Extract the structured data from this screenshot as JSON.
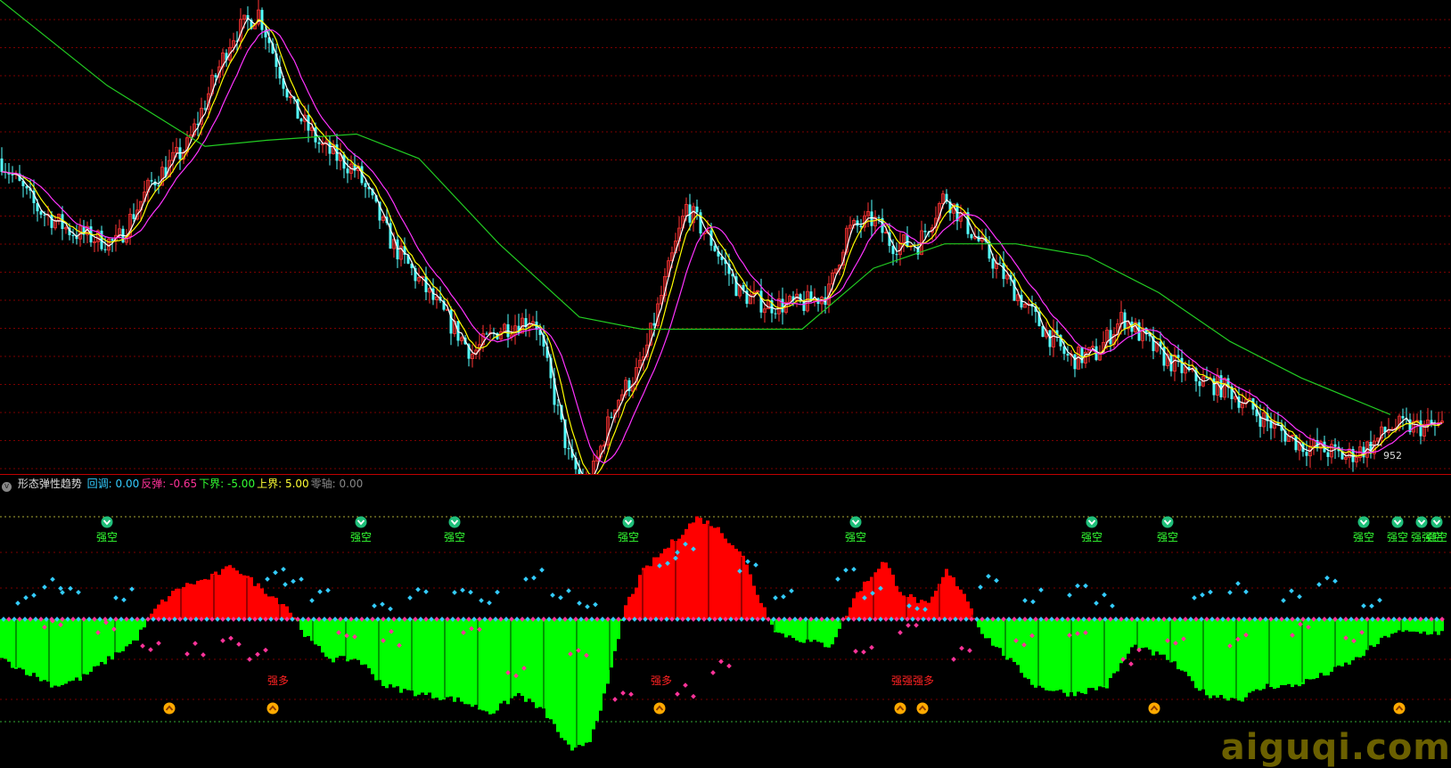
{
  "indicator": {
    "name": "形态弹性趋势",
    "items": [
      {
        "label": "回调",
        "value": "0.00",
        "color": "#33ccff"
      },
      {
        "label": "反弹",
        "value": "-0.65",
        "color": "#ff3399"
      },
      {
        "label": "下界",
        "value": "-5.00",
        "color": "#33ff33"
      },
      {
        "label": "上界",
        "value": "5.00",
        "color": "#ffff33"
      },
      {
        "label": "零轴",
        "value": "0.00",
        "color": "#888888"
      }
    ]
  },
  "price_low_label": "952",
  "watermark": "aiguqi.com",
  "colors": {
    "up": "#ff3333",
    "down": "#54ffff",
    "ma_short": "#ffffff",
    "ma_mid": "#ffff00",
    "ma_long": "#ff33ff",
    "ma_trend": "#22cc22",
    "hist_pos": "#ff0000",
    "hist_neg": "#00ff00",
    "grid": "#7a0000"
  },
  "chart_data": [
    {
      "type": "candlestick",
      "title": "",
      "series": [
        {
          "kind": "close-path",
          "x": [
            0,
            40,
            80,
            130,
            170,
            210,
            260,
            290,
            330,
            360,
            400,
            440,
            490,
            530,
            560,
            600,
            640,
            660,
            690,
            720,
            770,
            800,
            830,
            860,
            900,
            930,
            950,
            980,
            1000,
            1030,
            1060,
            1090,
            1120,
            1160,
            1200,
            1230,
            1260,
            1300,
            1340,
            1380,
            1420,
            1460,
            1490,
            1510,
            1540,
            1560
          ],
          "y": [
            1130,
            1090,
            1070,
            1060,
            1110,
            1140,
            1230,
            1250,
            1170,
            1140,
            1120,
            1060,
            1010,
            970,
            990,
            1000,
            880,
            860,
            930,
            960,
            1090,
            1060,
            1020,
            1010,
            1010,
            1020,
            1070,
            1080,
            1060,
            1060,
            1100,
            1070,
            1040,
            1000,
            965,
            970,
            1000,
            970,
            950,
            940,
            915,
            895,
            890,
            885,
            895,
            910
          ]
        },
        {
          "kind": "ma-trend",
          "x": [
            0,
            120,
            230,
            300,
            400,
            470,
            560,
            650,
            720,
            800,
            900,
            980,
            1060,
            1140,
            1220,
            1300,
            1380,
            1460,
            1560
          ],
          "y": [
            1260,
            1190,
            1140,
            1145,
            1150,
            1130,
            1060,
            1000,
            990,
            990,
            990,
            1040,
            1060,
            1060,
            1050,
            1020,
            980,
            950,
            920
          ]
        }
      ],
      "ylim": [
        880,
        1260
      ],
      "annotations": [
        {
          "text": "952",
          "kind": "low-marker"
        }
      ]
    },
    {
      "type": "bar",
      "title": "形态弹性趋势",
      "series": [
        {
          "name": "histogram",
          "x": [
            0,
            30,
            60,
            90,
            120,
            150,
            175,
            200,
            230,
            260,
            290,
            320,
            345,
            370,
            400,
            430,
            470,
            510,
            550,
            580,
            610,
            640,
            660,
            680,
            700,
            720,
            750,
            780,
            800,
            830,
            850,
            870,
            900,
            930,
            960,
            990,
            1010,
            1040,
            1060,
            1080,
            1100,
            1130,
            1160,
            1200,
            1240,
            1270,
            1310,
            1350,
            1390,
            1420,
            1450,
            1490,
            1520,
            1560
          ],
          "values": [
            -1.5,
            -2.0,
            -2.5,
            -2.2,
            -1.5,
            -0.8,
            0.5,
            1.2,
            1.5,
            2.0,
            1.2,
            0.5,
            -0.8,
            -1.5,
            -1.5,
            -2.5,
            -2.8,
            -3.0,
            -3.5,
            -2.8,
            -3.5,
            -5.0,
            -4.5,
            -2.5,
            0.5,
            1.8,
            2.8,
            3.8,
            3.5,
            2.5,
            0.8,
            -0.5,
            -0.8,
            -1.0,
            1.0,
            2.2,
            1.0,
            0.5,
            1.8,
            1.0,
            -0.5,
            -1.5,
            -2.5,
            -2.8,
            -2.5,
            -1.0,
            -1.5,
            -2.8,
            -3.0,
            -2.5,
            -2.5,
            -2.0,
            -1.5,
            -0.5
          ]
        },
        {
          "name": "回调",
          "x": [
            20,
            50,
            70,
            130,
            300,
            320,
            350,
            420,
            460,
            510,
            540,
            590,
            620,
            650,
            740,
            760,
            830,
            870,
            940,
            970,
            1020,
            1100,
            1150,
            1200,
            1230,
            1340,
            1380,
            1440,
            1480,
            1530
          ],
          "values": [
            0.6,
            1.2,
            1.0,
            0.8,
            1.5,
            1.3,
            0.7,
            0.5,
            0.8,
            1.0,
            0.7,
            1.5,
            0.9,
            0.6,
            2.0,
            2.5,
            1.8,
            0.8,
            1.5,
            0.8,
            0.5,
            1.2,
            0.7,
            0.9,
            0.6,
            0.8,
            1.0,
            0.7,
            1.3,
            0.5
          ]
        },
        {
          "name": "反弹",
          "x": [
            50,
            110,
            160,
            210,
            250,
            280,
            380,
            430,
            520,
            570,
            640,
            690,
            760,
            800,
            960,
            1010,
            1070,
            1140,
            1200,
            1260,
            1310,
            1380,
            1450,
            1510
          ],
          "values": [
            -0.3,
            -0.5,
            -1.0,
            -1.3,
            -0.8,
            -1.5,
            -0.5,
            -0.8,
            -0.5,
            -2.0,
            -1.3,
            -3.0,
            -2.8,
            -2.0,
            -1.2,
            -0.5,
            -1.5,
            -0.8,
            -0.6,
            -1.5,
            -0.8,
            -1.0,
            -0.6,
            -0.7
          ]
        }
      ],
      "ylim": [
        -5.0,
        5.0
      ],
      "reference_lines": {
        "上界": 5.0,
        "下界": -5.0,
        "零轴": 0.0
      },
      "signals": [
        {
          "text": "强空",
          "color": "#33ff33"
        },
        {
          "text": "强空",
          "color": "#33ff33"
        },
        {
          "text": "强空",
          "color": "#33ff33"
        },
        {
          "text": "强空",
          "color": "#33ff33"
        },
        {
          "text": "强空",
          "color": "#33ff33"
        },
        {
          "text": "强空",
          "color": "#33ff33"
        },
        {
          "text": "强空",
          "color": "#33ff33"
        },
        {
          "text": "强空",
          "color": "#33ff33"
        },
        {
          "text": "强空",
          "color": "#33ff33"
        },
        {
          "text": "强强空",
          "color": "#33ff33"
        },
        {
          "text": "强空",
          "color": "#33ff33"
        },
        {
          "text": "强多",
          "color": "#ff2222"
        },
        {
          "text": "强多",
          "color": "#ff2222"
        },
        {
          "text": "强强强多",
          "color": "#ff2222"
        }
      ]
    }
  ]
}
